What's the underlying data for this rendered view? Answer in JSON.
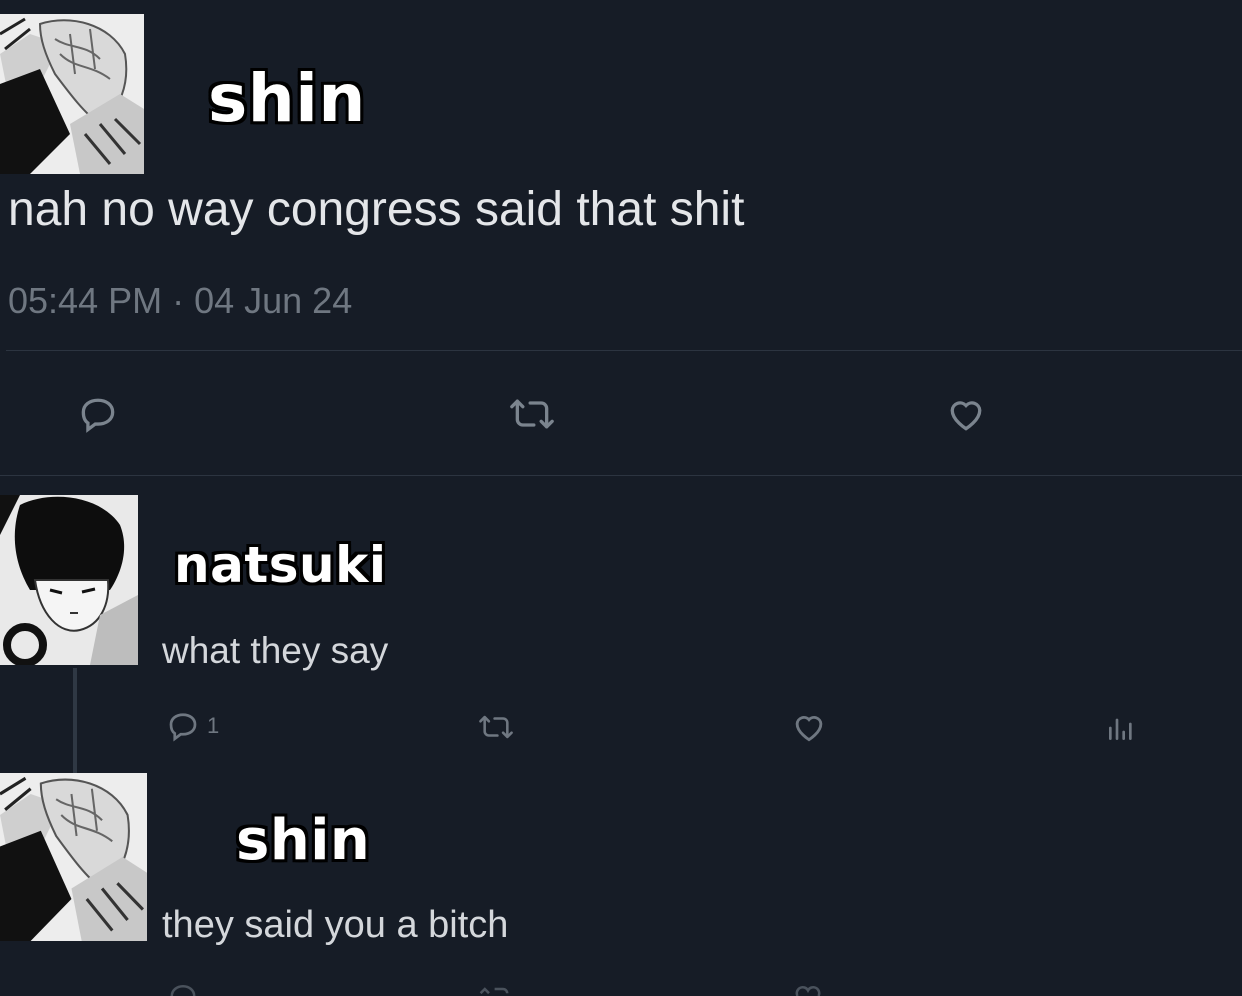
{
  "main_tweet": {
    "author": "shin",
    "text": "nah no way congress said that shit",
    "timestamp": "05:44 PM · 04 Jun 24",
    "actions": [
      "reply-icon",
      "retweet-icon",
      "like-icon"
    ]
  },
  "reply_1": {
    "author": "natsuki",
    "text": "what they say",
    "reply_count": "1",
    "actions": [
      "reply-icon",
      "retweet-icon",
      "like-icon",
      "analytics-icon"
    ]
  },
  "reply_2": {
    "author": "shin",
    "text": "they said you a bitch"
  },
  "colors": {
    "background": "#161c26",
    "icon": "#7b848e",
    "muted_text": "#6f7781"
  }
}
